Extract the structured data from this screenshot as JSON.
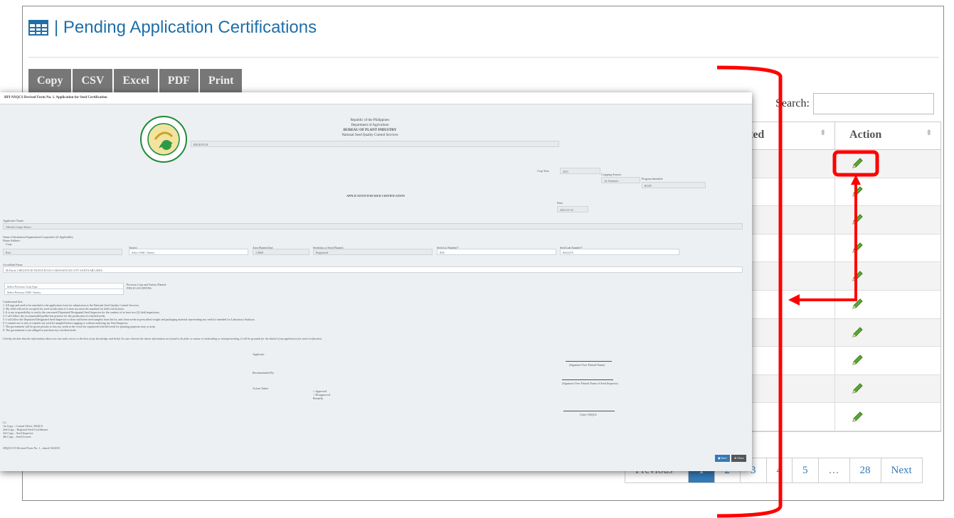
{
  "page": {
    "title": "| Pending Application Certifications"
  },
  "toolbar": {
    "buttons": [
      "Copy",
      "CSV",
      "Excel",
      "PDF",
      "Print"
    ]
  },
  "search": {
    "label": "Search:",
    "value": ""
  },
  "table": {
    "headers": [
      "ated",
      "Action"
    ],
    "rows": 10,
    "row_icon": "pencil-icon"
  },
  "pagination": {
    "prev": "Previous",
    "pages": [
      "1",
      "2",
      "3",
      "4",
      "5",
      "…",
      "28"
    ],
    "active": "1",
    "next": "Next"
  },
  "form": {
    "header": "BPI-NSQCS Revised Form No. 1. Application for Seed Certification",
    "gov": [
      "Republic of the Philippines",
      "Department of Agriculture",
      "BUREAU OF PLANT INDUSTRY",
      "National Seed Quality Control Services"
    ],
    "region": "REGION III",
    "crop_year_label": "Crop Year:",
    "crop_year": "2021",
    "cropping_season_label": "Cropping Season:",
    "cropping_season": "1st Semester",
    "program_label": "Program Intended:",
    "program": "RCEF",
    "heading": "APPLICATION FOR SEED CERTIFICATION",
    "date_label": "Date:",
    "date": "2021-01-16",
    "applicant_label": "Applicant's Name:",
    "applicant": "Alfredo Crispo Siboro",
    "org_label": "Name of Institution/Organization/Cooperative (if Applicable):",
    "home_label": "Home Address:",
    "crop_label": "Crop:",
    "crop": "Rice",
    "variety_label": "Variety:",
    "variety": "Select NSIC Variety",
    "area_label": "Area Planted (ha):",
    "area": "1.0000",
    "seed_class_label": "Seedclass of Seed Planted:",
    "seed_class": "Registered",
    "seed_lot_label": "Seed Lot Number*:",
    "seed_lot": "R20",
    "lab_label": "Seed Lab Number*:",
    "lab": "RS22270",
    "farm_label": "Accredited Farm:",
    "farm": "06 Purok 2 REGION III NUEVA ECIJA CABANATUAN CITY SANTA ARCADIA",
    "prev_crop_type": "Select Previous Crop Type",
    "prev_variety": "Select Previous NSIC Variety",
    "prev_label": "Previous Crop and Variety Planted",
    "field_loc": "FIELD LOCATIONS:",
    "understood": "I understand that:",
    "terms": [
      "1. All tags and seed to be attached to the application form for submission to the National Seed Quality Control Services.",
      "2. My field will not be accepted for seed certification if it does not meet the standard for field certification.",
      "3. It is my responsibility to notify the concerned Deputized Designated Seed Inspector for the conduct of at least two (2) field inspections.",
      "4. I will follow the recommended pollen-test practice for the production of certified seeds.",
      "5. I will allow the Deputized Designated Seed Inspector to draw sufficient seed samples from the lot, and clean seeds in prescribed weight and packaging material representing my seed lot intended for Laboratory Analysis.",
      "6. I commit not to mix or transfer my seed lot sampled before tagging or without notifying my Seed Inspector.",
      "7. The government will be given priority to buy my seeds in the event for registered/certified seeds for planting purposes may so arise.",
      "8. The government is not obliged to purchase my certified seeds."
    ],
    "declaration": "I hereby declare that the information above are true and correct to the best of my knowledge and belief. In case wherein the above information are found to be false or untrue or misleading or misrepresenting, it will be grounds for the denial of my application for seed certification.",
    "applicant_sig": "Applicant:",
    "sig1": "(Signature Over Printed Name)",
    "recommended": "Recommended By:",
    "sig2": "(Signature Over Printed Name of Seed Inspector)",
    "action_taken": "Action Taken:",
    "approved": "Approved",
    "disapproved": "Disapproved",
    "remarks": "Remarks",
    "chief": "Chief, NSQCS",
    "cc": [
      "Cc:",
      "1st Copy – Central Office, NSQCS",
      "2nd Copy – Regional Seed Coordinator",
      "3rd Copy – Seed Inspector",
      "4th Copy – Seed Grower"
    ],
    "footer": "NSQCS-CO Revised Form No. 1 – dated 3/4/2015",
    "save": "Save",
    "close": "Close"
  },
  "colors": {
    "title_blue": "#1e6fa8",
    "annotation_red": "#ff0000",
    "active_page": "#337ab7"
  }
}
